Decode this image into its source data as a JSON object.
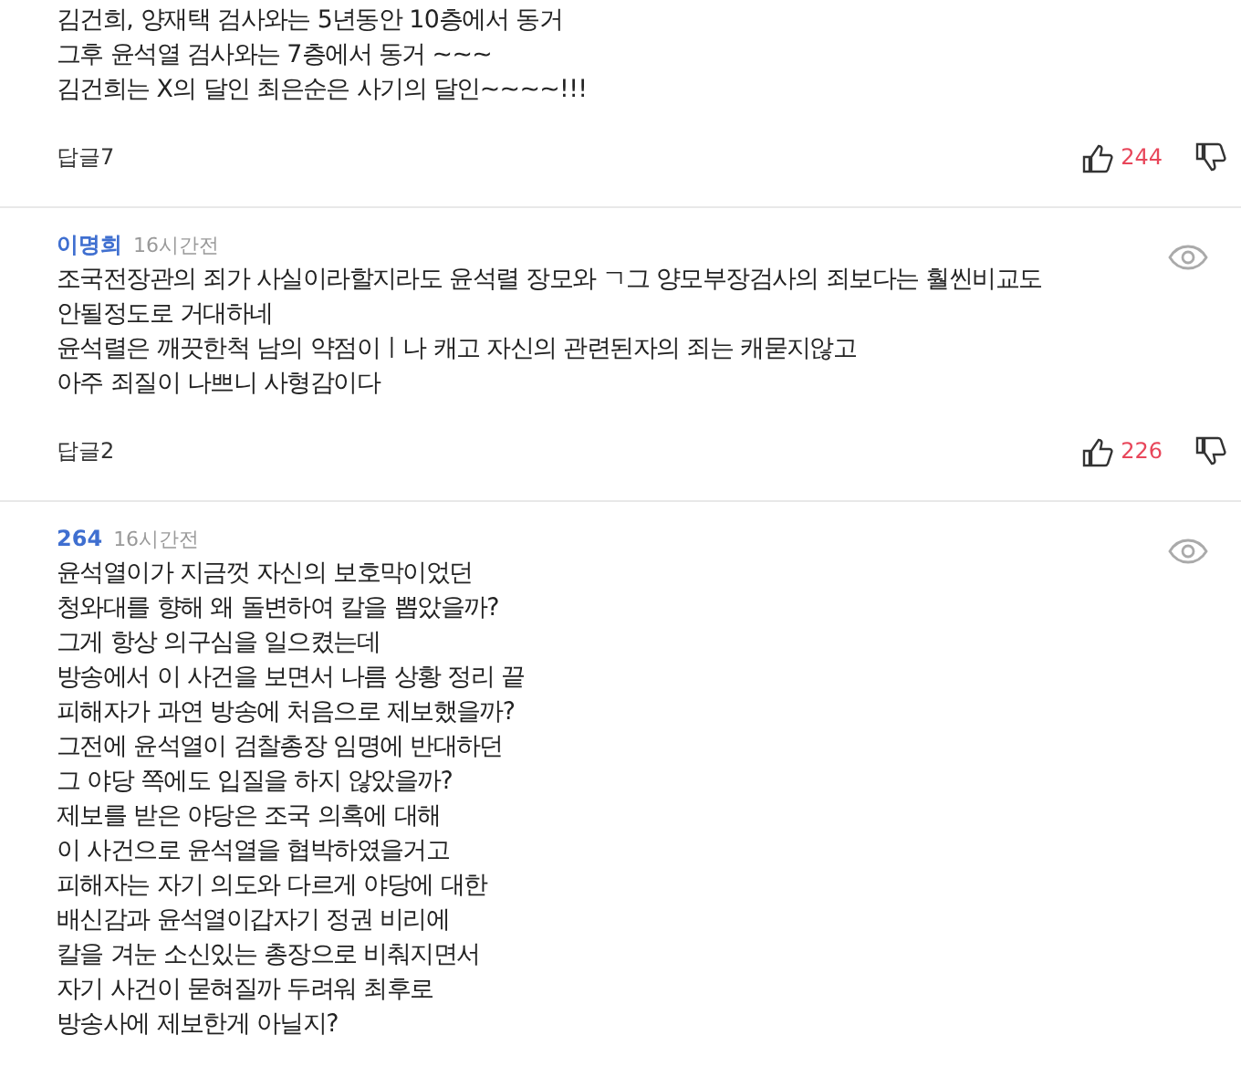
{
  "comments": [
    {
      "body": [
        "김건희,  양재택 검사와는 5년동안 10층에서 동거",
        "그후 윤석열 검사와는 7층에서 동거 ~~~",
        "김건희는 X의 달인 최은순은 사기의 달인~~~~!!!"
      ],
      "replies": "답글7",
      "likes": "244"
    },
    {
      "author": "이명희",
      "time": "16시간전",
      "body": [
        "조국전장관의 죄가 사실이라할지라도 윤석렬 장모와 ㄱ그 양모부장검사의 죄보다는 훨씬비교도",
        "안될정도로 거대하네",
        "윤석렬은 깨끗한척 남의 약점이ㅣ나 캐고 자신의 관련된자의 죄는 캐묻지않고",
        "아주 죄질이 나쁘니 사형감이다"
      ],
      "replies": "답글2",
      "likes": "226"
    },
    {
      "author": "264",
      "time": "16시간전",
      "body": [
        "윤석열이가 지금껏 자신의 보호막이었던",
        "청와대를 향해 왜 돌변하여 칼을 뽑았을까?",
        "그게 항상 의구심을 일으켰는데",
        "방송에서 이 사건을 보면서 나름 상황 정리 끝",
        "피해자가 과연 방송에 처음으로 제보했을까?",
        "그전에 윤석열이 검찰총장 임명에 반대하던",
        "그 야당 쪽에도 입질을 하지 않았을까?",
        "제보를 받은 야당은 조국 의혹에 대해",
        "이 사건으로 윤석열을 협박하였을거고",
        "피해자는 자기 의도와 다르게 야당에 대한",
        "배신감과 윤석열이갑자기 정권 비리에",
        "칼을 겨눈 소신있는 총장으로 비춰지면서",
        "자기 사건이 묻혀질까 두려워 최후로",
        "방송사에 제보한게 아닐지?"
      ]
    }
  ]
}
